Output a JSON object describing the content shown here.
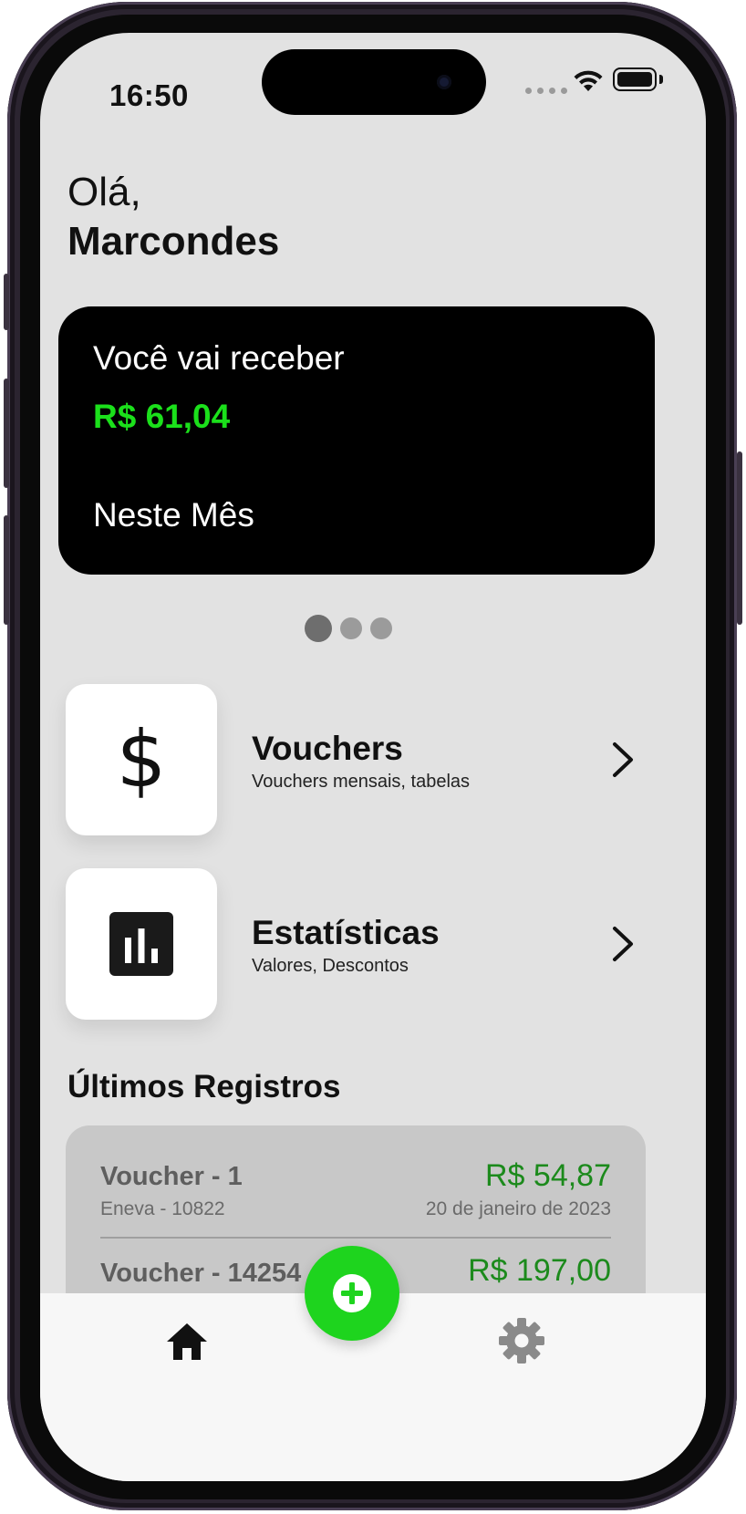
{
  "status_bar": {
    "time": "16:50"
  },
  "greeting": {
    "line1": "Olá,",
    "name": "Marcondes"
  },
  "balance_card": {
    "title": "Você vai receber",
    "amount": "R$ 61,04",
    "period": "Neste Mês",
    "amount_color": "#1be01b"
  },
  "pagination": {
    "total": 3,
    "active": 1
  },
  "menu": [
    {
      "title": "Vouchers",
      "subtitle": "Vouchers mensais, tabelas",
      "icon": "dollar-icon",
      "glyph": "$"
    },
    {
      "title": "Estatísticas",
      "subtitle": "Valores, Descontos",
      "icon": "bar-chart-icon"
    }
  ],
  "records_section": {
    "title": "Últimos Registros"
  },
  "records": [
    {
      "title": "Voucher - 1",
      "subtitle": "Eneva  - 10822",
      "amount": "R$ 54,87",
      "date": "20 de janeiro de 2023"
    },
    {
      "title": "Voucher - 14254",
      "amount": "R$ 197,00"
    }
  ],
  "bottom_nav": {
    "home_icon": "home-icon",
    "settings_icon": "gear-icon",
    "fab_icon": "plus-circle-icon"
  },
  "colors": {
    "accent_green": "#1ed41e",
    "amount_green": "#1c8a1c",
    "screen_bg": "#e2e2e2",
    "card_bg": "#000000"
  }
}
